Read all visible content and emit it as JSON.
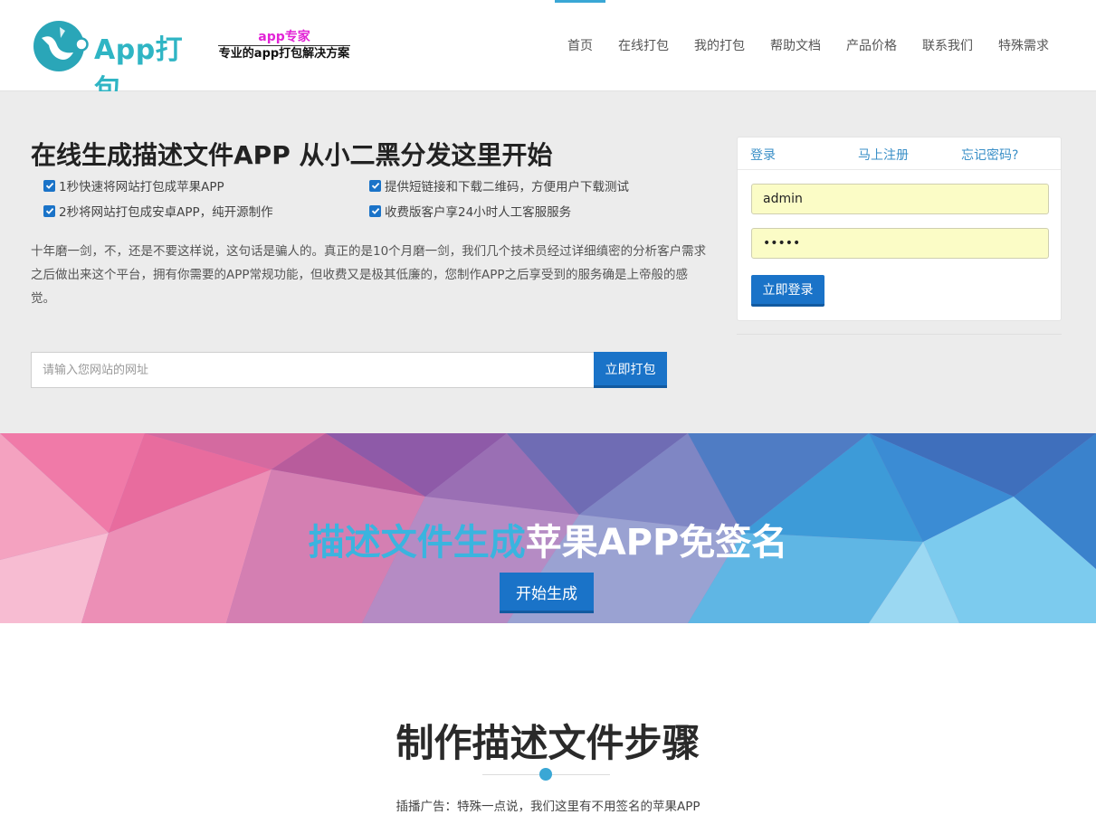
{
  "header": {
    "logo_text": "App打包",
    "slogan_top": "app专家",
    "slogan_bottom": "专业的app打包解决方案",
    "nav": [
      "首页",
      "在线打包",
      "我的打包",
      "帮助文档",
      "产品价格",
      "联系我们",
      "特殊需求"
    ],
    "active_nav": "首页"
  },
  "hero": {
    "title": "在线生成描述文件APP 从小二黑分发这里开始",
    "features": [
      "1秒快速将网站打包成苹果APP",
      "提供短链接和下载二维码，方便用户下载测试",
      "2秒将网站打包成安卓APP，纯开源制作",
      "收费版客户享24小时人工客服服务"
    ],
    "intro": "十年磨一剑，不，还是不要这样说，这句话是骗人的。真正的是10个月磨一剑，我们几个技术员经过详细缜密的分析客户需求之后做出来这个平台，拥有你需要的APP常规功能，但收费又是极其低廉的，您制作APP之后享受到的服务确是上帝般的感觉。",
    "url_placeholder": "请输入您网站的网址",
    "pack_button": "立即打包"
  },
  "login": {
    "tab_login": "登录",
    "tab_register": "马上注册",
    "tab_forgot": "忘记密码?",
    "username_value": "admin",
    "password_value": "•••••",
    "submit_label": "立即登录"
  },
  "banner": {
    "title_blue": "描述文件生成",
    "title_white": "苹果APP免签名",
    "button_label": "开始生成"
  },
  "steps": {
    "title": "制作描述文件步骤",
    "subtitle": "插播广告：特殊一点说，我们这里有不用签名的苹果APP"
  },
  "colors": {
    "accent": "#1a73c8",
    "logo": "#2fb5c4",
    "slogan": "#e224d6",
    "autofill": "#fbfcc6",
    "banner_blue_text": "#3ab4df"
  }
}
